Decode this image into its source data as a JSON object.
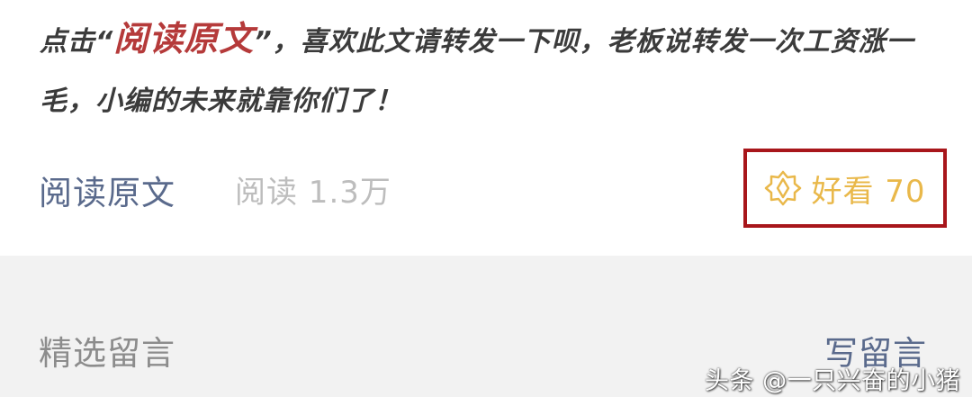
{
  "article": {
    "promo_prefix": "点击“",
    "promo_highlight": "阅读原文",
    "promo_suffix": "”，喜欢此文请转发一下呗，老板说转发一次工资涨一毛，小编的未来就靠你们了！"
  },
  "footer": {
    "read_original_label": "阅读原文",
    "read_count_label": "阅读 1.3万",
    "like_label": "好看 70",
    "like_icon": "wow-star-icon"
  },
  "comments": {
    "section_title": "精选留言",
    "write_label": "写留言"
  },
  "watermark": {
    "text": "头条 @一只兴奋的小猪"
  },
  "colors": {
    "promo_text": "#3b3b3b",
    "highlight": "#b53a3a",
    "link": "#5a6a8c",
    "muted": "#bdbdbd",
    "like": "#e9b84a",
    "highlight_box": "#a8161b",
    "comment_bg": "#f2f2f2"
  }
}
